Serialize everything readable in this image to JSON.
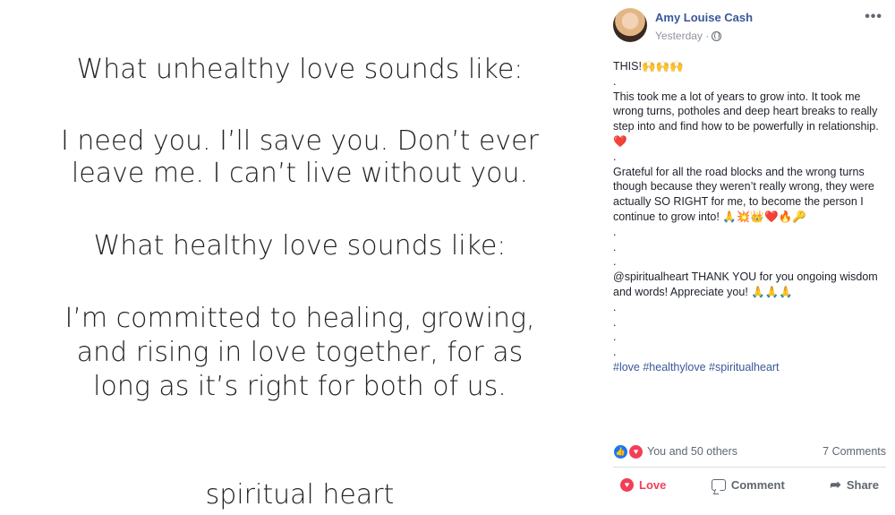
{
  "image": {
    "lines": [
      "What unhealthy love sounds like:",
      "I need you. I’ll save you. Don’t ever",
      "leave me. I can’t live without you.",
      "What healthy love sounds like:",
      "I’m committed to healing, growing,",
      "and rising in love together, for as",
      "long as it’s right for both of us.",
      "spiritual heart"
    ]
  },
  "post": {
    "author": "Amy Louise Cash",
    "timestamp": "Yesterday ·",
    "body": [
      "THIS!🙌🙌🙌",
      ".",
      "This took me a lot of years to grow into. It took me wrong turns, potholes and deep heart breaks to really step into and find how to be powerfully in relationship.❤️",
      ".",
      "Grateful for all the road blocks and the wrong turns though because they weren’t really wrong, they were actually SO RIGHT for me, to become the person I continue to grow into! 🙏💥👑❤️🔥🔑",
      ".",
      ".",
      ".",
      "@spiritualheart THANK YOU for you ongoing wisdom and words! Appreciate you! 🙏🙏🙏",
      ".",
      ".",
      ".",
      "."
    ],
    "hashtags": "#love #healthylove #spiritualheart",
    "reactions_text": "You and 50 others",
    "comments_count": "7 Comments",
    "actions": {
      "love": "Love",
      "comment": "Comment",
      "share": "Share"
    }
  },
  "colors": {
    "link": "#385898",
    "love": "#f33e58",
    "like": "#1877f2",
    "muted": "#606770"
  }
}
